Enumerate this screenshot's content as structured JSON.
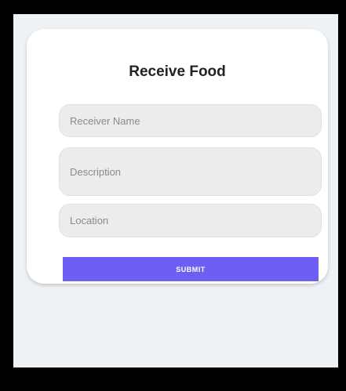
{
  "form": {
    "title": "Receive Food",
    "receiver_name_placeholder": "Receiver Name",
    "description_placeholder": "Description",
    "location_placeholder": "Location",
    "submit_label": "SUBMIT"
  },
  "colors": {
    "accent": "#6c5ff2",
    "background": "#eef1f5",
    "card": "#ffffff",
    "field": "#ececec"
  }
}
